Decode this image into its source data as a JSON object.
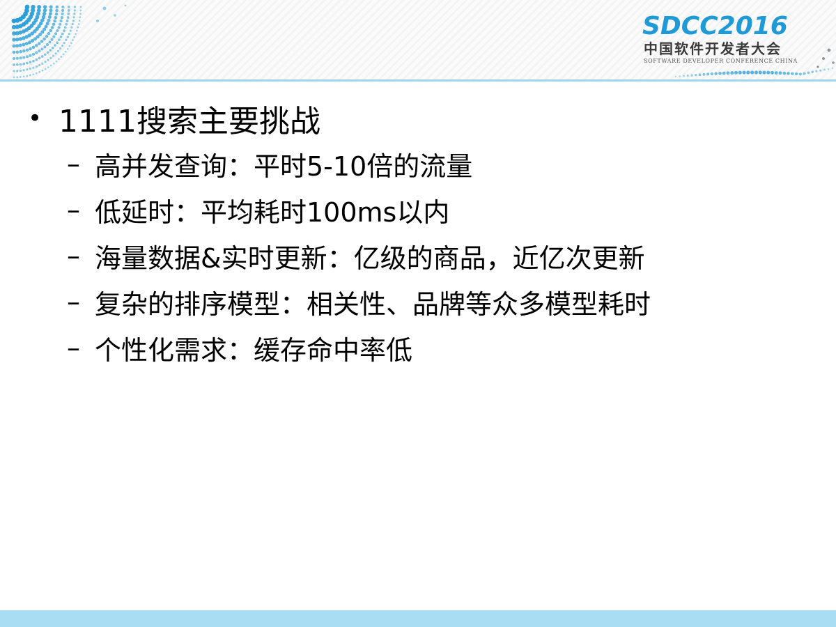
{
  "logo": {
    "main": "SDCC2016",
    "chinese": "中国软件开发者大会",
    "english": "SOFTWARE DEVELOPER CONFERENCE CHINA"
  },
  "bullets": {
    "marker": "•",
    "dash": "–",
    "title": "1111搜索主要挑战",
    "items": [
      "高并发查询：平时5-10倍的流量",
      "低延时：平均耗时100ms以内",
      "海量数据&实时更新：亿级的商品，近亿次更新",
      "复杂的排序模型：相关性、品牌等众多模型耗时",
      "个性化需求：缓存命中率低"
    ]
  },
  "colors": {
    "accent": "#1f9ad6",
    "header_line": "#9fd6ee",
    "footer": "#a9ddf4"
  }
}
